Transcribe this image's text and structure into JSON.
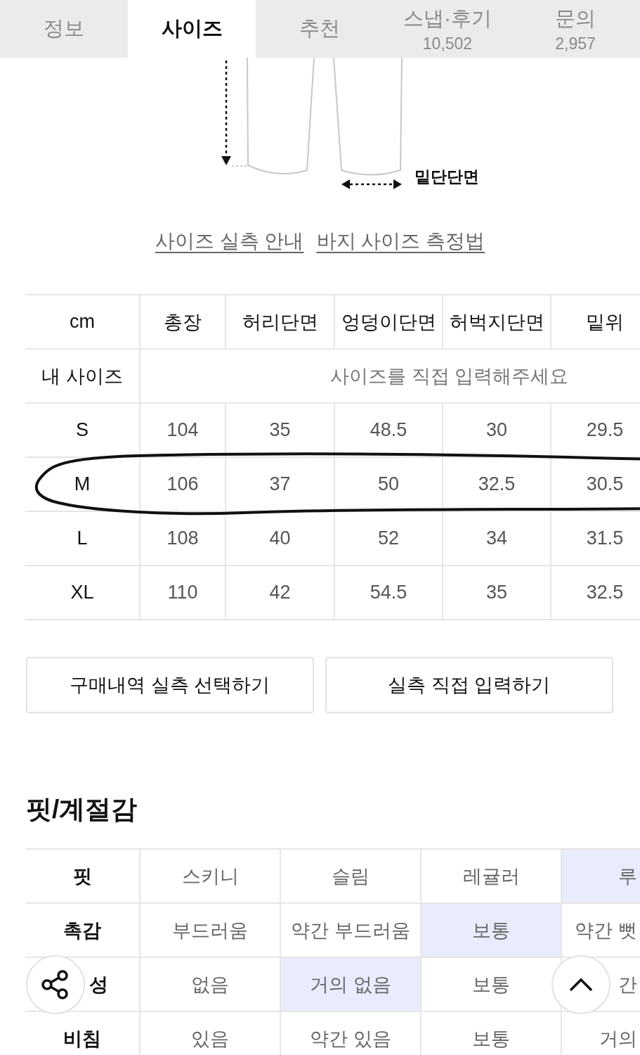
{
  "tabs": [
    {
      "label": "정보",
      "selected": false
    },
    {
      "label": "사이즈",
      "selected": true
    },
    {
      "label": "추천",
      "selected": false
    },
    {
      "label": "스냅·후기",
      "count": "10,502",
      "selected": false
    },
    {
      "label": "문의",
      "count": "2,957",
      "selected": false
    }
  ],
  "diagram": {
    "label": "밑단단면"
  },
  "guide_links": [
    "사이즈 실측 안내",
    "바지 사이즈 측정법"
  ],
  "size_table": {
    "columns": [
      "cm",
      "총장",
      "허리단면",
      "엉덩이단면",
      "허벅지단면",
      "밑위"
    ],
    "my_size": {
      "label": "내 사이즈",
      "placeholder": "사이즈를 직접 입력해주세요"
    },
    "rows": [
      {
        "size": "S",
        "values": [
          "104",
          "35",
          "48.5",
          "30",
          "29.5"
        ],
        "highlighted": false
      },
      {
        "size": "M",
        "values": [
          "106",
          "37",
          "50",
          "32.5",
          "30.5"
        ],
        "highlighted": true
      },
      {
        "size": "L",
        "values": [
          "108",
          "40",
          "52",
          "34",
          "31.5"
        ],
        "highlighted": false
      },
      {
        "size": "XL",
        "values": [
          "110",
          "42",
          "54.5",
          "35",
          "32.5"
        ],
        "highlighted": false
      }
    ]
  },
  "actions": [
    "구매내역 실측 선택하기",
    "실측 직접 입력하기"
  ],
  "fit_section": {
    "title": "핏/계절감",
    "rows": [
      {
        "label": "핏",
        "cut_start": false,
        "options": [
          {
            "text": "스키니",
            "selected": false
          },
          {
            "text": "슬림",
            "selected": false
          },
          {
            "text": "레귤러",
            "selected": false
          },
          {
            "text": "루",
            "selected": true
          }
        ]
      },
      {
        "label": "촉감",
        "cut_start": false,
        "options": [
          {
            "text": "부드러움",
            "selected": false
          },
          {
            "text": "약간 부드러움",
            "selected": false
          },
          {
            "text": "보통",
            "selected": true
          },
          {
            "text": "약간 뻣",
            "selected": false
          }
        ]
      },
      {
        "label": "성",
        "cut_start": true,
        "options": [
          {
            "text": "없음",
            "selected": false
          },
          {
            "text": "거의 없음",
            "selected": true
          },
          {
            "text": "보통",
            "selected": false
          },
          {
            "text": "간",
            "selected": false
          }
        ]
      },
      {
        "label": "비침",
        "cut_start": false,
        "options": [
          {
            "text": "있음",
            "selected": false
          },
          {
            "text": "약간 있음",
            "selected": false
          },
          {
            "text": "보통",
            "selected": false
          },
          {
            "text": "거의",
            "selected": false
          }
        ]
      }
    ]
  }
}
